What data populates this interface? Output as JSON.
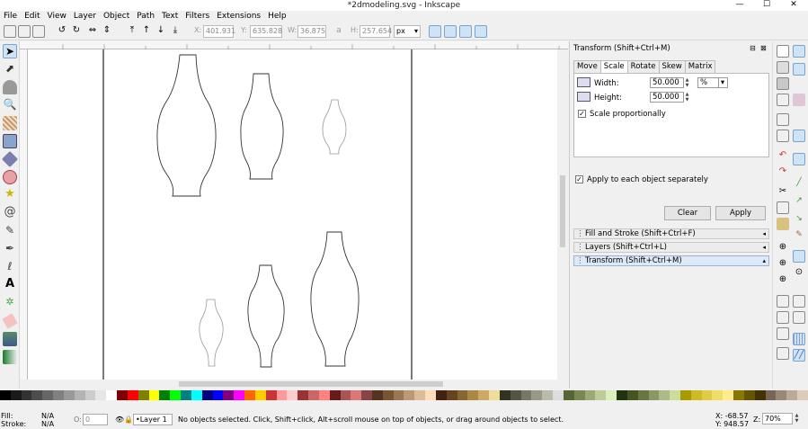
{
  "window": {
    "title": "*2dmodeling.svg - Inkscape",
    "minimize": "—",
    "maximize": "☐",
    "close": "✕"
  },
  "menu": [
    "File",
    "Edit",
    "View",
    "Layer",
    "Object",
    "Path",
    "Text",
    "Filters",
    "Extensions",
    "Help"
  ],
  "toolbar": {
    "x_label": "X:",
    "x_value": "401.931",
    "y_label": "Y:",
    "y_value": "635.828",
    "w_label": "W:",
    "w_value": "36.875",
    "h_label": "H:",
    "h_value": "257.654",
    "unit": "px"
  },
  "transform_panel": {
    "title": "Transform (Shift+Ctrl+M)",
    "tabs": [
      "Move",
      "Scale",
      "Rotate",
      "Skew",
      "Matrix"
    ],
    "selected_tab": "Scale",
    "width_label": "Width:",
    "width_value": "50.000",
    "height_label": "Height:",
    "height_value": "50.000",
    "unit": "%",
    "scale_proportionally": "Scale proportionally",
    "apply_each": "Apply to each object separately",
    "clear": "Clear",
    "apply": "Apply"
  },
  "docked_dialogs": [
    "Fill and Stroke (Shift+Ctrl+F)",
    "Layers (Shift+Ctrl+L)",
    "Transform (Shift+Ctrl+M)"
  ],
  "status": {
    "fill_label": "Fill:",
    "fill_value": "N/A",
    "stroke_label": "Stroke:",
    "stroke_value": "N/A",
    "opacity_label": "O:",
    "opacity_value": "0",
    "layer": "•Layer 1",
    "message": "No objects selected. Click, Shift+click, Alt+scroll mouse on top of objects, or drag around objects to select.",
    "x_coord": "X: -68.57",
    "y_coord": "Y: 948.57",
    "zoom_label": "Z:",
    "zoom": "70%"
  },
  "palette_colors": [
    "#000000",
    "#1a1a1a",
    "#333333",
    "#4d4d4d",
    "#666666",
    "#808080",
    "#999999",
    "#b3b3b3",
    "#cccccc",
    "#e6e6e6",
    "#ffffff",
    "#800000",
    "#ff0000",
    "#808000",
    "#ffff00",
    "#008000",
    "#00ff00",
    "#008080",
    "#00ffff",
    "#000080",
    "#0000ff",
    "#800080",
    "#ff00ff",
    "#ff6600",
    "#ffcc00",
    "#cc3333",
    "#ff9999",
    "#ffcccc",
    "#993333",
    "#cc6666",
    "#ff8080",
    "#661a1a",
    "#aa5555",
    "#dd7777",
    "#884444",
    "#553322",
    "#775533",
    "#997755",
    "#bb9977",
    "#ddbb99",
    "#ffddbb",
    "#442211",
    "#664422",
    "#886633",
    "#aa8844",
    "#ccaa66",
    "#eedd99",
    "#333322",
    "#555544",
    "#777766",
    "#999988",
    "#bbbbaa",
    "#dddddd",
    "#556633",
    "#778855",
    "#99aa77",
    "#bbcc99",
    "#ddeebb",
    "#223311",
    "#445522",
    "#667744",
    "#889966",
    "#aabb88",
    "#ccdd99",
    "#aa9900",
    "#ccbb22",
    "#ddcc44",
    "#eedd66",
    "#ffee88",
    "#887700",
    "#665500",
    "#443300",
    "#776655",
    "#998877",
    "#bbaa99",
    "#ddccbb"
  ]
}
